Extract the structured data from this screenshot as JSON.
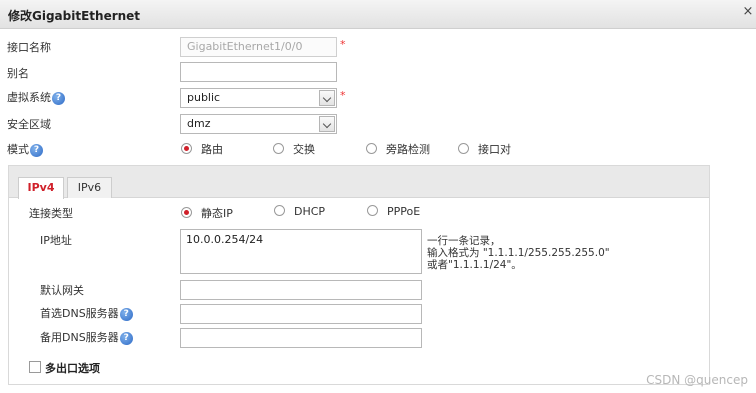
{
  "dialog": {
    "title": "修改GigabitEthernet",
    "close_glyph": "×"
  },
  "form": {
    "interface_name_label": "接口名称",
    "interface_name_value": "GigabitEthernet1/0/0",
    "alias_label": "别名",
    "alias_value": "",
    "vsys_label": "虚拟系统",
    "vsys_value": "public",
    "zone_label": "安全区域",
    "zone_value": "dmz",
    "mode_label": "模式",
    "mode_options": [
      "路由",
      "交换",
      "旁路检测",
      "接口对"
    ],
    "mode_selected": "路由",
    "required_mark": "*"
  },
  "tabs": [
    "IPv4",
    "IPv6"
  ],
  "ipv4": {
    "conn_type_label": "连接类型",
    "conn_options": [
      "静态IP",
      "DHCP",
      "PPPoE"
    ],
    "conn_selected": "静态IP",
    "ip_label": "IP地址",
    "ip_value": "10.0.0.254/24",
    "ip_hint": [
      "一行一条记录，",
      "输入格式为 \"1.1.1.1/255.255.255.0\"",
      "或者\"1.1.1.1/24\"。"
    ],
    "gateway_label": "默认网关",
    "gateway_value": "",
    "dns1_label": "首选DNS服务器",
    "dns1_value": "",
    "dns2_label": "备用DNS服务器",
    "dns2_value": "",
    "multi_exit_label": "多出口选项",
    "multi_exit_checked": false
  },
  "watermark": "CSDN @quencep",
  "help_glyph": "?",
  "colors": {
    "accent_red": "#d0202a",
    "help_blue": "#2e6bc7"
  }
}
